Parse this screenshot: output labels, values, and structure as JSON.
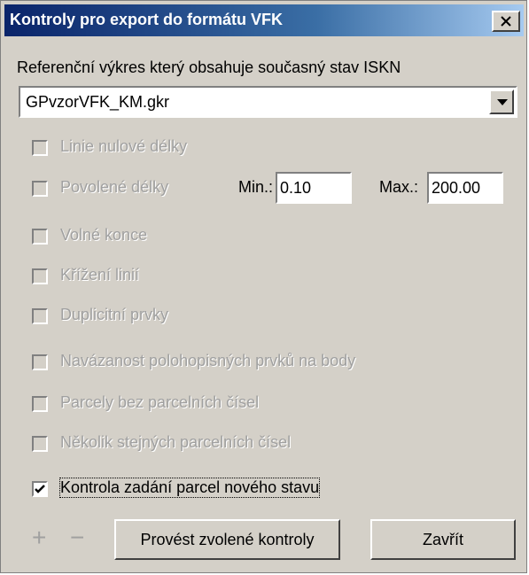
{
  "window": {
    "title": "Kontroly pro export do formátu VFK"
  },
  "reference": {
    "label": "Referenční výkres který obsahuje současný stav ISKN",
    "selected": "GPvzorVFK_KM.gkr"
  },
  "checks": [
    {
      "label": "Linie nulové délky",
      "checked": false,
      "enabled": false
    },
    {
      "label": "Povolené délky",
      "checked": false,
      "enabled": false
    },
    {
      "label": "Volné konce",
      "checked": false,
      "enabled": false
    },
    {
      "label": "Křížení linií",
      "checked": false,
      "enabled": false
    },
    {
      "label": "Duplicitní prvky",
      "checked": false,
      "enabled": false
    },
    {
      "label": "Navázanost polohopisných prvků na body",
      "checked": false,
      "enabled": false
    },
    {
      "label": "Parcely bez parcelních čísel",
      "checked": false,
      "enabled": false
    },
    {
      "label": "Několik stejných parcelních čísel",
      "checked": false,
      "enabled": false
    },
    {
      "label": "Kontrola zadání parcel nového stavu",
      "checked": true,
      "enabled": true
    }
  ],
  "lengths": {
    "min_label": "Min.:",
    "min_value": "0.10",
    "max_label": "Max.:",
    "max_value": "200.00"
  },
  "footer": {
    "plus": "+",
    "minus": "−",
    "run_label": "Provést zvolené kontroly",
    "close_label": "Zavřít"
  }
}
